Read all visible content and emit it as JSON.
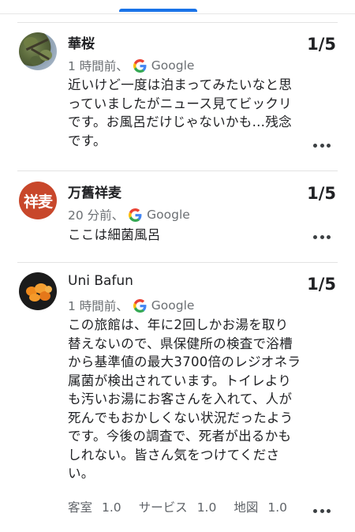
{
  "reviews": [
    {
      "name": "華桜",
      "time": "1 時間前、",
      "source": "Google",
      "rating": "1/5",
      "text_lines": [
        "近いけど一度は泊まってみたいなと思",
        "っていましたがニュース見てビックリ",
        "です。お風呂だけじゃないかも…残念",
        "です。"
      ],
      "avatar": "tree-photo"
    },
    {
      "name": "万舊祥麦",
      "time": "20 分前、",
      "source": "Google",
      "rating": "1/5",
      "text_lines": [
        "ここは細菌風呂"
      ],
      "avatar_text": "祥麦"
    },
    {
      "name": "Uni Bafun",
      "time": "1 時間前、",
      "source": "Google",
      "rating": "1/5",
      "text_lines": [
        "この旅館は、年に2回しかお湯を取り",
        "替えないので、県保健所の検査で浴槽",
        "から基準値の最大3700倍のレジオネラ",
        "属菌が検出されています。トイレより",
        "も汚いお湯にお客さんを入れて、人が",
        "死んでもおかしくない状況だったよう",
        "です。今後の調査で、死者が出るかも",
        "しれない。皆さん気をつけてくださ",
        "い。"
      ],
      "avatar": "uni-photo",
      "sub_ratings": [
        {
          "label": "客室",
          "value": "1.0"
        },
        {
          "label": "サービス",
          "value": "1.0"
        },
        {
          "label": "地図",
          "value": "1.0"
        }
      ]
    }
  ],
  "colors": {
    "accent": "#1a73e8",
    "avatar_text_bg": "#c8472b",
    "meta_text": "#6b6f73"
  },
  "icons": [
    "google-g-icon",
    "more-options-icon"
  ]
}
